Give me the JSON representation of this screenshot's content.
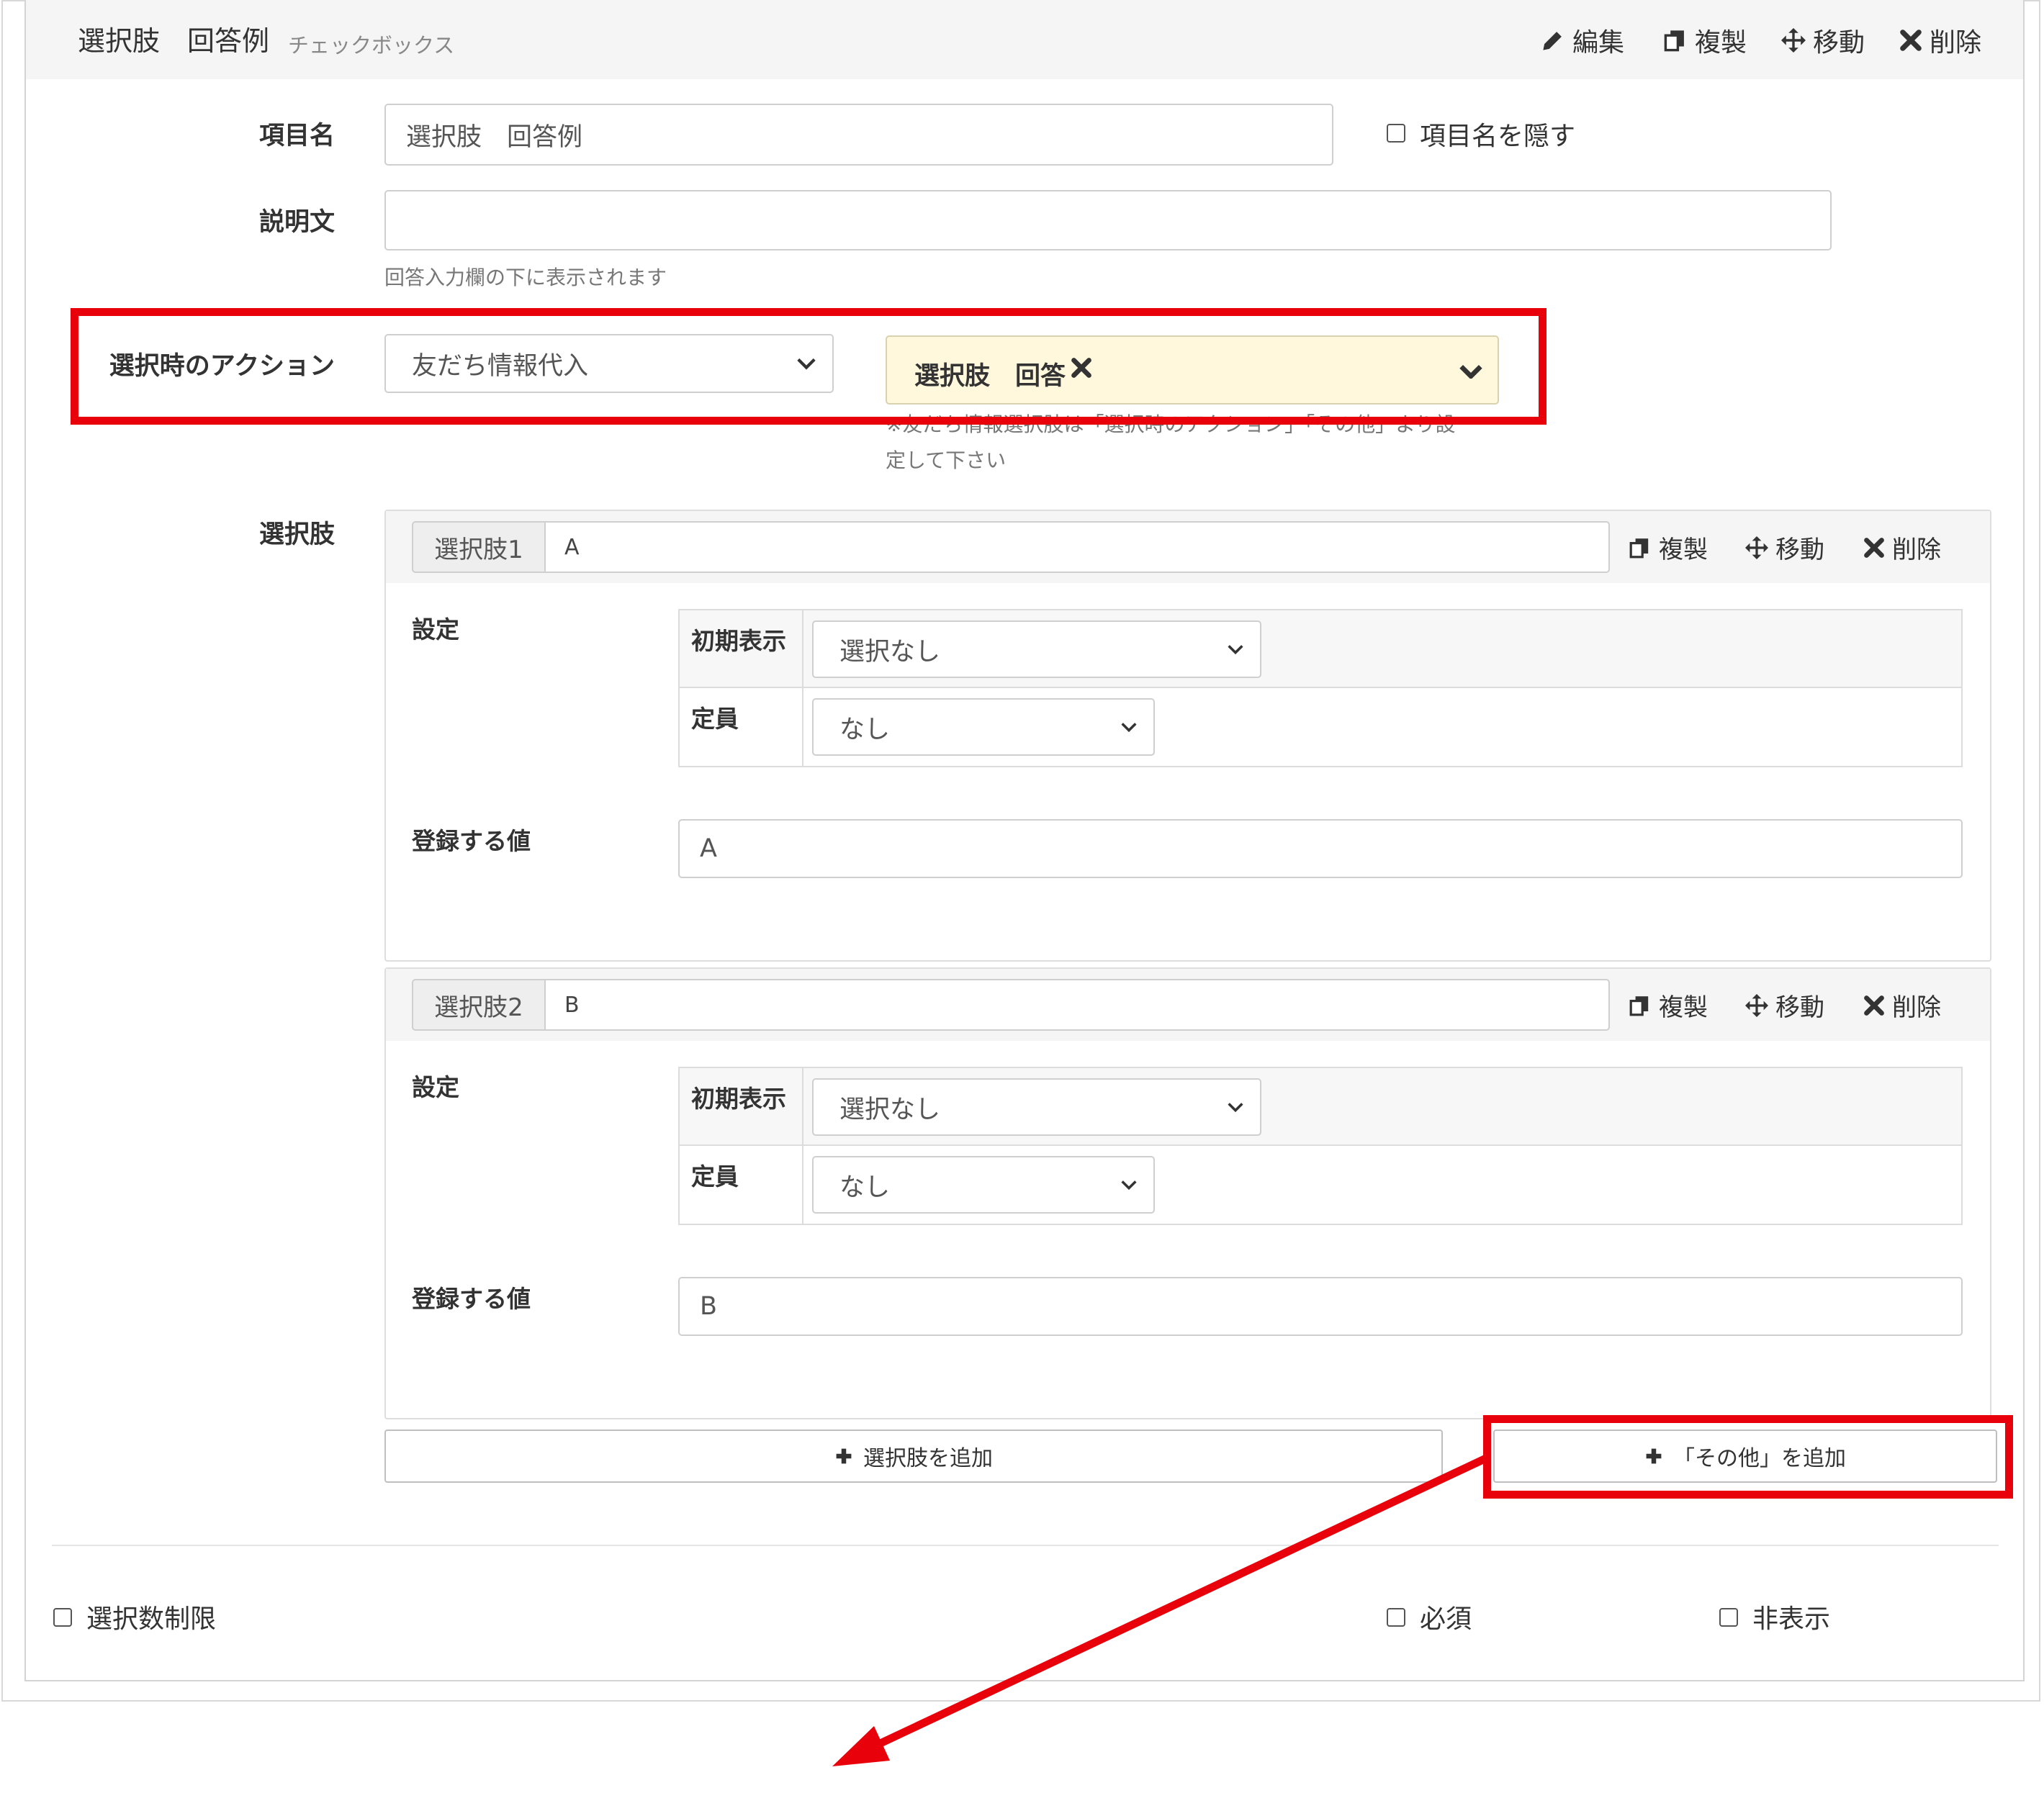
{
  "header": {
    "title": "選択肢　回答例",
    "subtitle": "チェックボックス",
    "actions": {
      "edit": "編集",
      "copy": "複製",
      "move": "移動",
      "delete": "削除"
    }
  },
  "form": {
    "item_name": {
      "label": "項目名",
      "value": "選択肢　回答例",
      "hide_label": "項目名を隠す",
      "hide_checked": false
    },
    "description": {
      "label": "説明文",
      "value": "",
      "help": "回答入力欄の下に表示されます"
    },
    "action": {
      "label": "選択時のアクション",
      "selected": "友だち情報代入",
      "tag": "選択肢　回答",
      "note_line1": "※友だち情報選択肢は「選択時のアクション」「その他」より設",
      "note_line2": "定して下さい"
    },
    "choices_label": "選択肢"
  },
  "choices": [
    {
      "addon": "選択肢1",
      "value": "A",
      "actions": {
        "copy": "複製",
        "move": "移動",
        "delete": "削除"
      },
      "settings_label": "設定",
      "initial_label": "初期表示",
      "initial_value": "選択なし",
      "capacity_label": "定員",
      "capacity_value": "なし",
      "register_label": "登録する値",
      "register_value": "A"
    },
    {
      "addon": "選択肢2",
      "value": "B",
      "actions": {
        "copy": "複製",
        "move": "移動",
        "delete": "削除"
      },
      "settings_label": "設定",
      "initial_label": "初期表示",
      "initial_value": "選択なし",
      "capacity_label": "定員",
      "capacity_value": "なし",
      "register_label": "登録する値",
      "register_value": "B"
    }
  ],
  "buttons": {
    "add_choice": "選択肢を追加",
    "add_other": "「その他」を追加"
  },
  "footer": {
    "limit": "選択数制限",
    "required": "必須",
    "hidden": "非表示"
  },
  "colors": {
    "highlight": "#e8000b",
    "tag_bg": "#fff8dc",
    "header_bg": "#f5f5f5"
  }
}
